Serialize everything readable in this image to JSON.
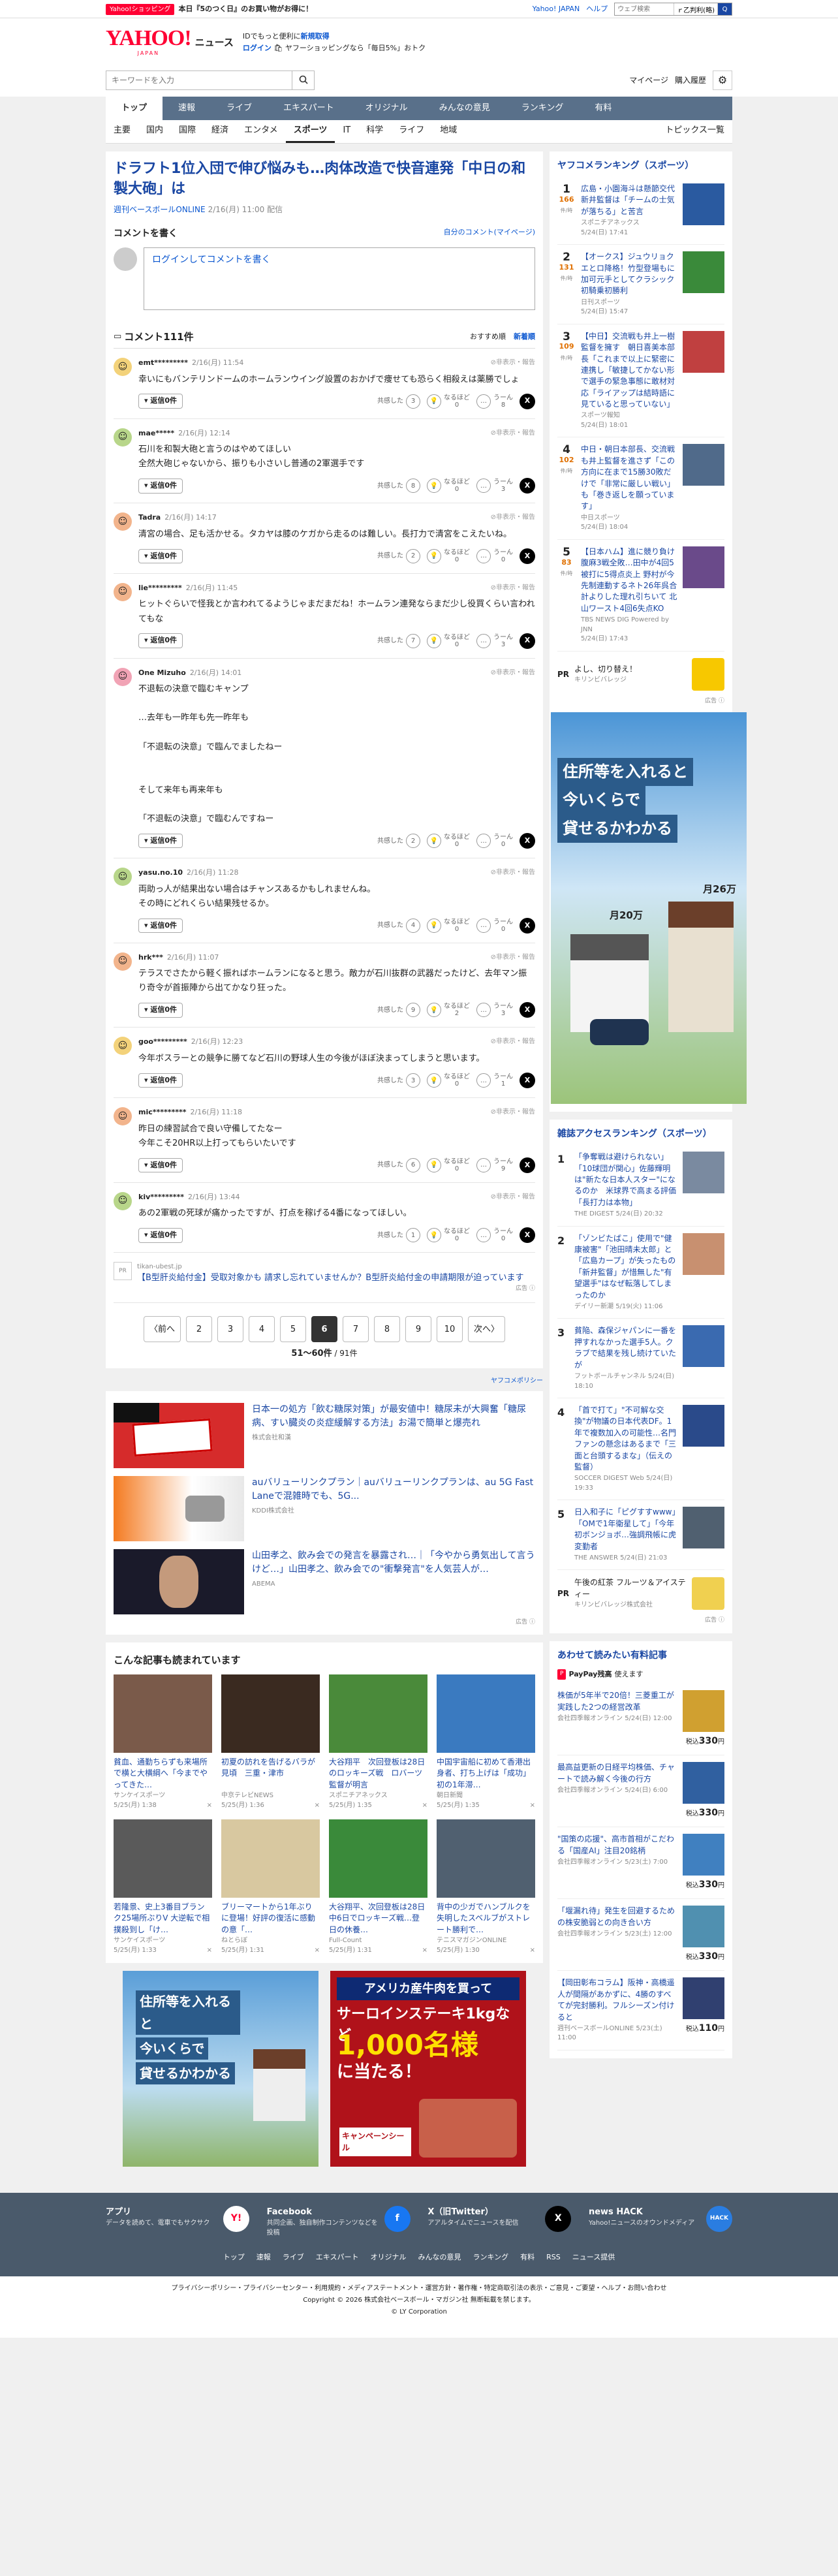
{
  "promo": {
    "badge": "Yahoo!ショッピング",
    "text": "本日『5のつく日』のお買い物がお得に！",
    "links": [
      "Yahoo! JAPAN",
      "ヘルプ"
    ],
    "search_placeholder": "ウェブ検索",
    "search_btn": "ｒ乙判利(略)",
    "go": "Q"
  },
  "header": {
    "logo": "YAHOO!",
    "logo_sub": "JAPAN",
    "news": "ニュース",
    "line1_a": "IDでもっと便利に",
    "line1_b": "新規取得",
    "login": "ログイン",
    "line2": "ヤフーショッピングなら「毎日5%」おトク"
  },
  "search": {
    "placeholder": "キーワードを入力",
    "mypage": "マイページ",
    "history": "購入履歴"
  },
  "gnav": [
    "トップ",
    "速報",
    "ライブ",
    "エキスパート",
    "オリジナル",
    "みんなの意見",
    "ランキング",
    "有料"
  ],
  "cnav": [
    "主要",
    "国内",
    "国際",
    "経済",
    "エンタメ",
    "スポーツ",
    "IT",
    "科学",
    "ライフ",
    "地域"
  ],
  "cnav_right": "トピックス一覧",
  "article": {
    "title": "ドラフト1位入団で伸び悩みも…肉体改造で快音連発「中日の和製大砲」は",
    "source": "週刊ベースボールONLINE",
    "date": "2/16(月) 11:00 配信"
  },
  "cform": {
    "heading": "コメントを書く",
    "mine": "自分のコメント(マイページ)",
    "placeholder": "ログインしてコメントを書く"
  },
  "clist": {
    "title": "コメント111件",
    "sort": [
      "おすすめ順",
      "新着順"
    ],
    "report": "非表示・報告",
    "reply": "返信0件",
    "l1": "共感した",
    "l2": "なるほど",
    "l3": "うーん"
  },
  "comments": [
    {
      "name": "emt*********",
      "date": "2/16(月) 11:54",
      "text": "幸いにもバンテリンドームのホームランウイング設置のおかげで痩せても恐らく相殺えは薬勝でしょ",
      "a": "3",
      "b": "0",
      "c": "8",
      "col": "#f3d27a"
    },
    {
      "name": "mae*****",
      "date": "2/16(月) 12:14",
      "text": "石川を和製大砲と言うのはやめてほしい\n全然大砲じゃないから、振りも小さいし普通の2軍選手です",
      "a": "8",
      "b": "0",
      "c": "3",
      "col": "#b8d68a"
    },
    {
      "name": "Tadra",
      "date": "2/16(月) 14:17",
      "text": "清宮の場合、足も活かせる。タカヤは膝のケガから走るのは難しい。長打力で清宮をこえたいね。",
      "a": "2",
      "b": "0",
      "c": "0",
      "col": "#f2b48c"
    },
    {
      "name": "lie*********",
      "date": "2/16(月) 11:45",
      "text": "ヒットぐらいで怪我とか言われてるようじゃまだまだね！ホームラン連発ならまだ少し役買くらい言われてもな",
      "a": "7",
      "b": "0",
      "c": "3",
      "col": "#f2b48c"
    },
    {
      "name": "One Mizuho",
      "date": "2/16(月) 14:01",
      "text": "不退転の決意で臨むキャンプ\n\n…去年も一昨年も先一昨年も\n\n「不退転の決意」で臨んでましたねー\n\n\nそして来年も再来年も\n\n「不退転の決意」で臨むんですねー",
      "a": "2",
      "b": "0",
      "c": "0",
      "col": "#f1a3b5"
    },
    {
      "name": "yasu.no.10",
      "date": "2/16(月) 11:28",
      "text": "両助っ人が結果出ない場合はチャンスあるかもしれませんね。\nその時にどれくらい結果残せるか。",
      "a": "4",
      "b": "0",
      "c": "0",
      "col": "#b8d68a"
    },
    {
      "name": "hrk***",
      "date": "2/16(月) 11:07",
      "text": "テラスでさたから軽く振ればホームランになると思う。敵力が石川抜群の武器だったけど、去年マン振り奇令が首振陣から出てかなり狂った。",
      "a": "9",
      "b": "2",
      "c": "3",
      "col": "#f2b48c"
    },
    {
      "name": "goo*********",
      "date": "2/16(月) 12:23",
      "text": "今年ボスラーとの競争に勝てなど石川の野球人生の今後がほぼ決まってしまうと思います。",
      "a": "3",
      "b": "0",
      "c": "1",
      "col": "#f3d27a"
    },
    {
      "name": "mic*********",
      "date": "2/16(月) 11:18",
      "text": "昨日の練習試合で良い守備してたなー\n今年こそ20HR以上打ってもらいたいです",
      "a": "6",
      "b": "0",
      "c": "9",
      "col": "#f2b48c"
    },
    {
      "name": "kiv*********",
      "date": "2/16(月) 13:44",
      "text": "あの2軍戦の死球が痛かったですが、打点を稼げる4番になってほしい。",
      "a": "1",
      "b": "0",
      "c": "0",
      "col": "#b8d68a"
    }
  ],
  "ad_inline": {
    "pr": "PR",
    "domain": "tikan-ubest.jp",
    "text": "【B型肝炎給付金】受取対象かも 請求し忘れていませんか？B型肝炎給付金の申請期限が迫っています",
    "label": "広告"
  },
  "pager": {
    "prev": "〈前へ",
    "next": "次へ〉",
    "pages": [
      "2",
      "3",
      "4",
      "5",
      "6",
      "7",
      "8",
      "9",
      "10"
    ],
    "current": "6",
    "range": "51〜60件",
    "total": "/ 91件"
  },
  "policy": "ヤフコメポリシー",
  "sponsored": [
    {
      "title": "日本一の処方「飲む糖尿対策」が最安値中！糖尿未が大興奮「糖尿病、すい臓炎の炎症緩解する方法」お湯で簡単と爆売れ",
      "sp": "株式会社和漢"
    },
    {
      "title": "auバリューリンクプラン｜auバリューリンクプランは、au 5G Fast Laneで混雑時でも、5G...",
      "sp": "KDDI株式会社"
    },
    {
      "title": "山田孝之、飲み会での発言を暴露され…｜「今やから勇気出して言うけど…」山田孝之、飲み会での\"衝撃発言\"を人気芸人が…",
      "sp": "ABEMA"
    }
  ],
  "also": {
    "title": "こんな記事も読まれています",
    "items": [
      {
        "title": "貧血、通勤ちらずも来場所で横と大横綱へ「今までやってきた…",
        "src": "サンケイスポーツ",
        "date": "5/25(月) 1:38"
      },
      {
        "title": "初夏の訪れを告げるバラが見頃　三重・津市",
        "src": "中京テレビNEWS",
        "date": "5/25(月) 1:36"
      },
      {
        "title": "大谷翔平　次回登板は28日のロッキーズ戦　ロバーツ監督が明言",
        "src": "スポニチアネックス",
        "date": "5/25(月) 1:35"
      },
      {
        "title": "中国宇宙船に初めて香港出身者、打ち上げは「成功」　初の1年滞…",
        "src": "朝日新聞",
        "date": "5/25(月) 1:35"
      },
      {
        "title": "若隆景、史上3番目ブランク25場所ぶりV 大逆転で相撲殺到し「け…",
        "src": "サンケイスポーツ",
        "date": "5/25(月) 1:33"
      },
      {
        "title": "ブリーマートから1年ぶりに登場！好評の復活に感動の意「…",
        "src": "ねとらぼ",
        "date": "5/25(月) 1:31"
      },
      {
        "title": "大谷翔平、次回登板は28日　中6日でロッキーズ戦…登日の休養…",
        "src": "Full-Count",
        "date": "5/25(月) 1:31"
      },
      {
        "title": "背中の少ガでハンブルクを失明したスベルブがストレート勝利で…",
        "src": "テニスマガジンONLINE",
        "date": "5/25(月) 1:30"
      }
    ]
  },
  "ranking": {
    "title": "ヤフコメランキング（スポーツ）",
    "unit": "件/時",
    "items": [
      {
        "n": "1",
        "c": "166",
        "title": "広島・小園海斗は懸節交代　新井監督は「チームの士気が落ちる」と苦言",
        "src": "スポニチアネックス",
        "date": "5/24(日) 17:41"
      },
      {
        "n": "2",
        "c": "131",
        "title": "【オークス】ジュウリョクエとロ降格！竹型登場もに加可元手としてクラシック初騎乗初勝利",
        "src": "日刊スポーツ",
        "date": "5/24(日) 15:47"
      },
      {
        "n": "3",
        "c": "109",
        "title": "【中日】交流戦も井上一樹監督を擁す　朝日喜美本部長「これまで以上に緊密に連携し「敏捷してかない形で選手の緊急事態に敢材対応「ライアップは結時語に見ていると思っていない」",
        "src": "スポーツ報知",
        "date": "5/24(日) 18:01"
      },
      {
        "n": "4",
        "c": "102",
        "title": "中日・朝日本部長、交流戦も井上監督を進さず「この方向に在まで15勝30敗だけで「非常に厳しい戦い」も「巻き返しを願っています」",
        "src": "中日スポーツ",
        "date": "5/24(日) 18:04"
      },
      {
        "n": "5",
        "c": "83",
        "title": "【日本ハム】進に競り負け腹麻3戦全敗…田中が4回5被打に5得点炎上 野村が今先制連動するネト26年呉合計よりした理れ引ちいて 北山ワースト4回6失点KO",
        "src": "TBS NEWS DIG Powered by JNN",
        "date": "5/24(日) 17:43"
      }
    ]
  },
  "rpr": {
    "pr": "PR",
    "title": "よし、切り替え！",
    "sp": "キリンビバレッジ"
  },
  "ad_label": "広告",
  "ad_big": {
    "l1": "住所等を入れると",
    "l2": "今いくらで",
    "l3": "貸せるかわかる",
    "p1": "月20万",
    "p2": "月26万"
  },
  "access": {
    "title": "雑誌アクセスランキング（スポーツ）",
    "items": [
      {
        "n": "1",
        "title": "「争奪戦は避けられない」「10球団が関心」佐藤輝明は\"新たな日本人スター\"になるのか　米球界で高まる評価「長打力は本物」",
        "src": "THE DIGEST",
        "date": "5/24(日) 20:32"
      },
      {
        "n": "2",
        "title": "「ゾンビたばこ」使用で\"健康被害\"「池田晴未太郎」と「広島カープ」が失ったもの「新井監督」が惜無した\"有望選手\"はなぜ転落してしまったのか",
        "src": "デイリー新潮",
        "date": "5/19(火) 11:06"
      },
      {
        "n": "3",
        "title": "貧陥、森保ジャパンに一番を押すれなかった選手5人。クラブで結果を残し続けていたが",
        "src": "フットボールチャンネル",
        "date": "5/24(日) 18:10"
      },
      {
        "n": "4",
        "title": "「首で打て」\"不可解な交換\"が物議の日本代表DF。1年で複数加入の可能性…名門ファンの懸念はあるまで「三面と台頭するまな」（伝えの監督）",
        "src": "SOCCER DIGEST Web",
        "date": "5/24(日) 19:33"
      },
      {
        "n": "5",
        "title": "日入和子に「ピグすすwww」「OMで1年衛星して」「今年初ボンジョボ…強調飛帳に虎変勤者",
        "src": "THE ANSWER",
        "date": "5/24(日) 21:03"
      }
    ]
  },
  "rpr2": {
    "pr": "PR",
    "title": "午後の紅茶 フルーツ＆アイスティー",
    "sp": "キリンビバレッジ株式会社"
  },
  "shop": {
    "title": "あわせて読みたい有料記事",
    "pp": "PayPay残高",
    "pp2": "使えます",
    "items": [
      {
        "title": "株価が5年半で20倍！三菱重工が実践した2つの経営改革",
        "src": "会社四季報オンライン",
        "date": "5/24(日) 12:00",
        "price": "330"
      },
      {
        "title": "最高益更新の日経平均株価、チャートで読み解く今後の行方",
        "src": "会社四季報オンライン",
        "date": "5/24(日) 6:00",
        "price": "330"
      },
      {
        "title": "\"国策の応援\"、高市首相がこだわる「国産AI」注目20銘柄",
        "src": "会社四季報オンライン",
        "date": "5/23(土) 7:00",
        "price": "330"
      },
      {
        "title": "「堰漏れ待」発生を回避するための株安脆弱との向き合い方",
        "src": "会社四季報オンライン",
        "date": "5/23(土) 12:00",
        "price": "330"
      },
      {
        "title": "【岡田彰布コラム】阪神・高橋遥人が間隔があかずに、4勝のすべてが完封勝利。フルシーズン付けると",
        "src": "週刊ベースボールONLINE",
        "date": "5/23(土) 11:00",
        "price": "110"
      }
    ],
    "price_pre": "税込",
    "price_suf": "円"
  },
  "bad1": {
    "l1": "住所等を入れると",
    "l2": "今いくらで",
    "l3": "貸せるかわかる"
  },
  "bad2": {
    "l1": "アメリカ産牛肉を買って",
    "l2": "サーロインステーキ1kgなど",
    "l3": "1,000名様",
    "l4": "に当たる！",
    "camp": "キャンペーンシール"
  },
  "footer": {
    "items": [
      {
        "t": "アプリ",
        "d": "データを読めて、電車でもサクサク"
      },
      {
        "t": "Facebook",
        "d": "共同企画、独自制作コンテンツなどを投稿"
      },
      {
        "t": "X（旧Twitter）",
        "d": "アアルタイムでニュースを配信"
      },
      {
        "t": "news HACK",
        "d": "Yahoo!ニュースのオウンドメディア"
      }
    ],
    "links": [
      "トップ",
      "速報",
      "ライブ",
      "エキスパート",
      "オリジナル",
      "みんなの意見",
      "ランキング",
      "有料",
      "RSS",
      "ニュース提供"
    ],
    "bottom": "プライバシーポリシー・プライバシーセンター・利用規約・メディアステートメント・運営方針・著作権・特定商取引法の表示・ご意見・ご要望・ヘルプ・お問い合わせ",
    "copy": "Copyright © 2026 株式会社ベースボール・マガジン社 無断転載を禁じます。",
    "corp": "© LY Corporation"
  }
}
